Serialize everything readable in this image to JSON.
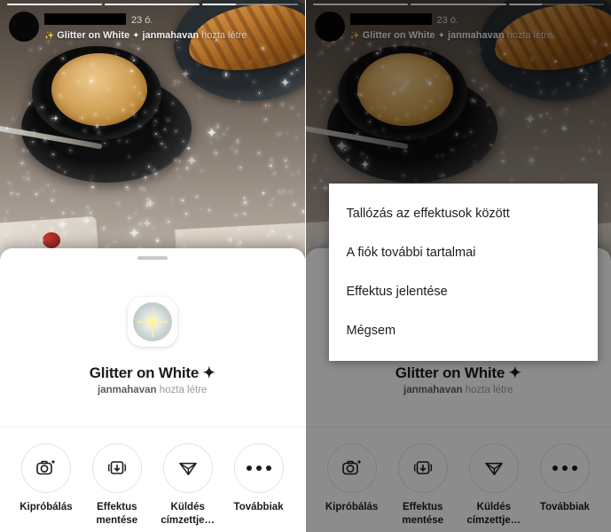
{
  "story": {
    "progress_segments": [
      100,
      100,
      35
    ],
    "username_redacted": true,
    "timestamp": "23 ó.",
    "effect_sparkle_icon": "✨",
    "effect_name": "Glitter on White",
    "effect_diamond": "✦",
    "author": "janmahavan",
    "created_by_suffix": "hozta létre"
  },
  "sheet": {
    "drag_handle": "drag-handle",
    "effect_icon_name": "glitter-effect-thumbnail",
    "title": "Glitter on White ✦",
    "author": "janmahavan",
    "author_suffix": "hozta létre",
    "actions": [
      {
        "icon": "camera-sparkle-icon",
        "label": "Kipróbálás"
      },
      {
        "icon": "save-download-icon",
        "label": "Effektus\nmentése"
      },
      {
        "icon": "send-paper-plane-icon",
        "label": "Küldés\ncímzettje…"
      },
      {
        "icon": "more-dots-icon",
        "label": "Továbbiak"
      }
    ],
    "action_labels_flat": [
      "Kipróbálás",
      "Effektus mentése",
      "Küldés címzettje…",
      "Továbbiak"
    ]
  },
  "dialog": {
    "visible_on": "right-panel",
    "items": [
      "Tallózás az effektusok között",
      "A fiók további tartalmai",
      "Effektus jelentése",
      "Mégsem"
    ]
  },
  "colors": {
    "sheet_background": "#ffffff",
    "title_text": "#1a1a1a",
    "subtitle_text": "#9a9a9a",
    "author_text": "#5f5f5f",
    "circle_border": "#e3e3e3",
    "separator": "#efefef",
    "handle": "#c9c9c9",
    "scrim": "rgba(0,0,0,0.45)",
    "dialog_text": "#1d1d1d"
  }
}
